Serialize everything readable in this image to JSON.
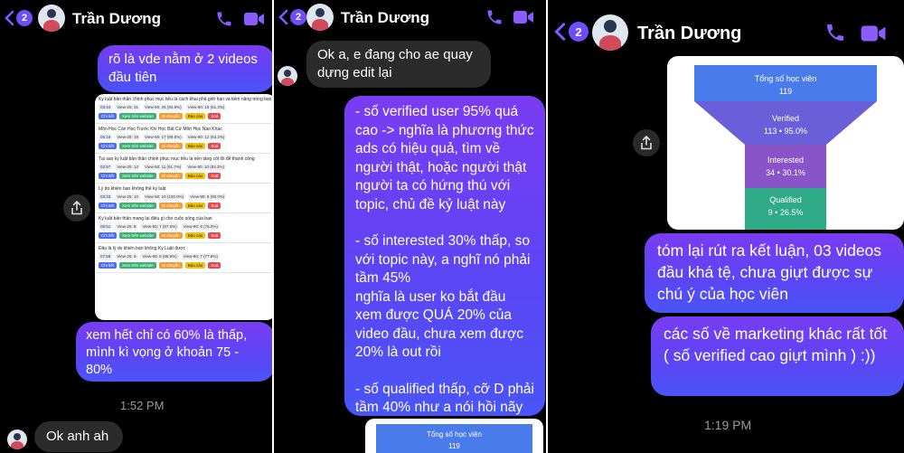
{
  "contact": {
    "name": "Trần Dương",
    "unread_count": "2"
  },
  "panel1": {
    "messages": [
      {
        "text": "rõ là vde nằm ở 2 videos đầu tiên"
      },
      {
        "text": "xem hết chỉ có 60% là thấp, mình kì vọng ở khoản 75 - 80%"
      }
    ],
    "time": "1:52 PM",
    "reply": "Ok anh ah",
    "table": {
      "rows": [
        {
          "title": "Kỷ luật bản thân chinh phục mục tiêu là cách khai phá giới hạn và tiềm năng trong bạn",
          "duration": "03:44",
          "view25": "View-25: 31",
          "view50": "View-50: 25 (83.9%)",
          "view90": "View-90: 19 (61.3%)"
        },
        {
          "title": "Môn Học Cần Học Trước Khi Học Bất Cứ Môn Học Nào Khác",
          "duration": "05:19",
          "view25": "View-25: 19",
          "view50": "View-50: 17 (89.5%)",
          "view90": "View-90: 12 (63.2%)"
        },
        {
          "title": "Tại sao kỷ luật bản thân chinh phục mục tiêu là nền tảng cốt lõi để thành công",
          "duration": "02:57",
          "view25": "View-25: 12",
          "view50": "View-50: 11 (91.7%)",
          "view90": "View-90: 10 (83.3%)"
        },
        {
          "title": "Lý do khiến bạn không thể kỷ luật",
          "duration": "03:33",
          "view25": "View-25: 10",
          "view50": "View-50: 10 (100.0%)",
          "view90": "View-90: 9 (90.0%)"
        },
        {
          "title": "Kỷ luật bản thân mang lại điều gì cho cuộc sống của bạn",
          "duration": "08:51",
          "view25": "View-25: 8",
          "view50": "View-50: 7 (87.5%)",
          "view90": "View-90: 6 (75.0%)"
        },
        {
          "title": "Đâu là lý do khiến bạn không Kỷ Luật được",
          "duration": "07:58",
          "view25": "View-25: 9",
          "view50": "View-50: 8 (88.9%)",
          "view90": "View-90: 7 (77.8%)"
        }
      ],
      "actions": {
        "detail": "Chi tiết",
        "website": "Xem trên website",
        "move": "Di chuyển",
        "report": "Báo cáo",
        "delete": "Xoá"
      }
    }
  },
  "panel2": {
    "incoming": "Ok a, e đang cho ae quay dựng edit lại",
    "long_message": [
      "- số verified user 95% quá cao -> nghĩa là phương thức ads có hiệu quả, tìm về người thật, hoặc người thật người ta có hứng thú với topic, chủ đề kỷ luật này",
      "",
      "- số interested 30% thấp, so với topic này, a nghĩ nó phải tầm 45%",
      "nghĩa là user ko bắt đầu xem được QUÁ 20% của video đầu, chưa xem được 20% là out rồi",
      "",
      "- số qualified thấp, cỡ D phải tầm 40% như a nói hồi nãy"
    ],
    "funnel_preview": {
      "title": "Tổng số học viên",
      "value": "119"
    }
  },
  "panel3": {
    "funnel": {
      "stages": [
        {
          "label": "Tổng số học viên",
          "value": "119",
          "color": "#4a7bea"
        },
        {
          "label": "Verified",
          "value": "113 • 95.0%",
          "color": "#6a5fd8"
        },
        {
          "label": "Interested",
          "value": "34 • 30.1%",
          "color": "#8a54c9"
        },
        {
          "label": "Qualified",
          "value": "9 • 26.5%",
          "color": "#2eaa86"
        }
      ]
    },
    "messages": [
      {
        "text": "tóm lại rút ra kết luận, 03 videos đầu khá tệ, chưa giựt được sự chú ý của học viên"
      },
      {
        "text": "các số về marketing khác rất tốt ( số verified cao giựt mình ) :))"
      }
    ],
    "time": "1:19 PM"
  },
  "icons": {
    "back": "chevron-left-icon",
    "phone": "phone-icon",
    "video": "video-camera-icon",
    "share": "share-icon"
  },
  "colors": {
    "accent": "#7b5cff",
    "bubble_me_top": "#7a3cf2",
    "bubble_me_bottom": "#4a55f6",
    "bubble_them": "#2b2b2b"
  }
}
